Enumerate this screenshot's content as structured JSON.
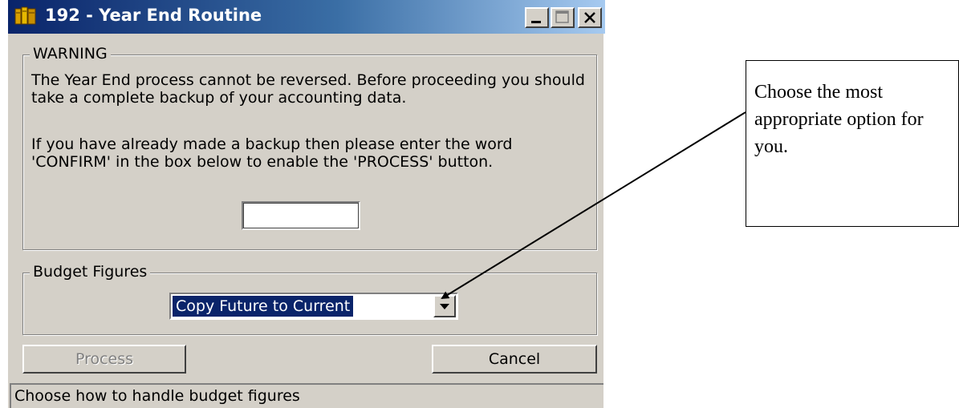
{
  "window": {
    "title": "192 - Year End Routine",
    "icon": "ledger-books-icon",
    "controls": [
      "minimize-icon",
      "maximize-icon",
      "close-icon"
    ]
  },
  "warning": {
    "legend": "WARNING",
    "paragraph1": "The Year End process cannot be reversed. Before proceeding you should take a complete backup of your accounting data.",
    "paragraph2": "If you have already made a backup then please enter the word 'CONFIRM' in the box below to enable the 'PROCESS' button.",
    "confirm_value": ""
  },
  "budget": {
    "legend": "Budget Figures",
    "selected": "Copy Future to Current"
  },
  "buttons": {
    "process": "Process",
    "cancel": "Cancel"
  },
  "status": {
    "text": "Choose how to handle budget figures"
  },
  "callout": {
    "text": "Choose the most appropriate option for you."
  },
  "colors": {
    "titlebar_start": "#0a246a",
    "titlebar_end": "#a6caf0",
    "dialog_face": "#d4d0c8",
    "selection": "#0a246a",
    "disabled_text": "#808080"
  }
}
